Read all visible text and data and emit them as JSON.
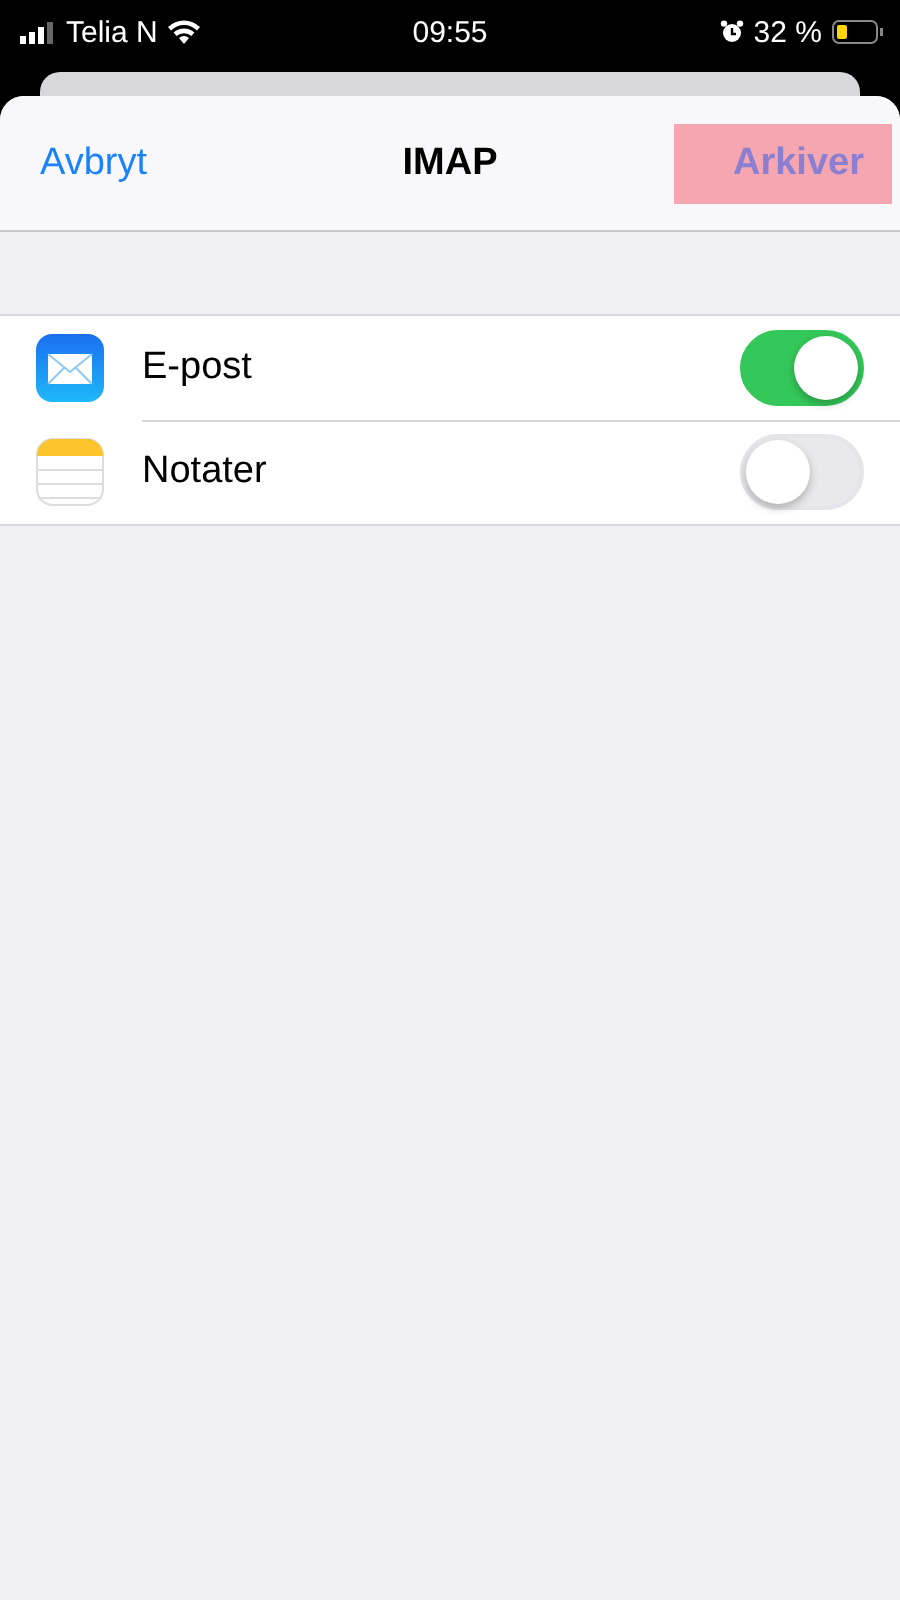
{
  "status_bar": {
    "carrier": "Telia N",
    "time": "09:55",
    "battery": "32 %"
  },
  "nav": {
    "cancel": "Avbryt",
    "title": "IMAP",
    "save": "Arkiver"
  },
  "rows": [
    {
      "kind": "mail",
      "label": "E-post",
      "on": true
    },
    {
      "kind": "notes",
      "label": "Notater",
      "on": false
    }
  ]
}
